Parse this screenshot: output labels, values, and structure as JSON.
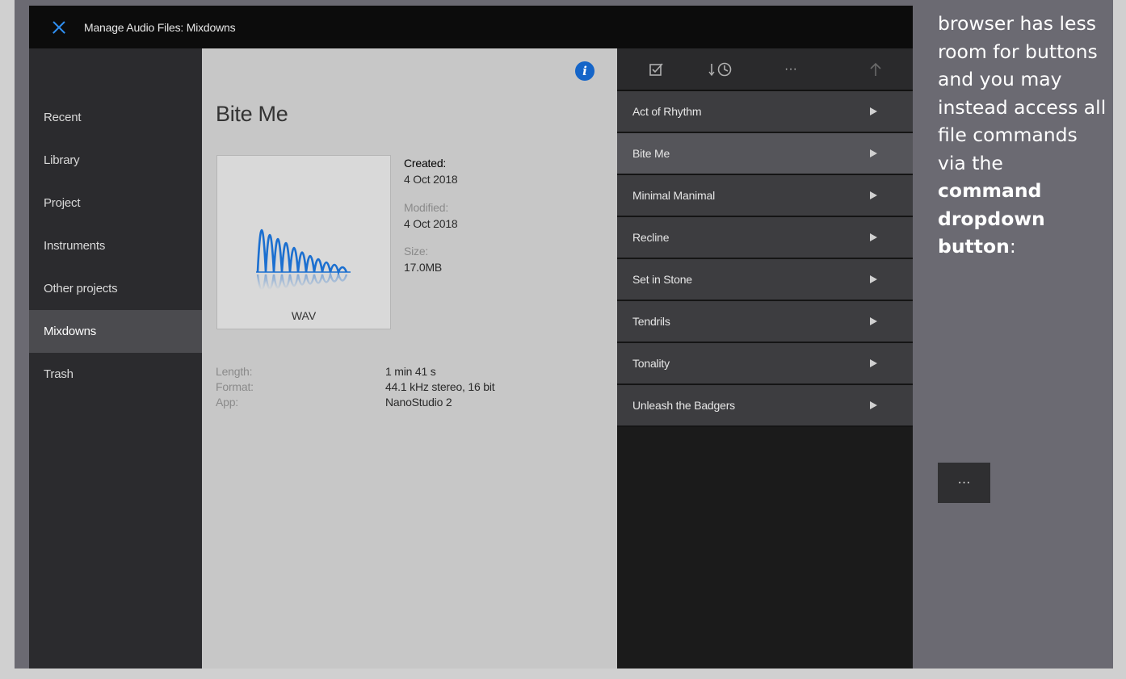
{
  "window": {
    "title": "Manage Audio Files: Mixdowns"
  },
  "sidebar": {
    "items": [
      {
        "label": "Recent"
      },
      {
        "label": "Library"
      },
      {
        "label": "Project"
      },
      {
        "label": "Instruments"
      },
      {
        "label": "Other projects"
      },
      {
        "label": "Mixdowns",
        "active": true
      },
      {
        "label": "Trash"
      }
    ]
  },
  "details": {
    "file_name": "Bite Me",
    "format_badge": "WAV",
    "created_label": "Created:",
    "created_value": "4 Oct 2018",
    "modified_label": "Modified:",
    "modified_value": "4 Oct 2018",
    "size_label": "Size:",
    "size_value": "17.0MB",
    "properties": [
      {
        "key": "Length:",
        "value": "1 min 41 s"
      },
      {
        "key": "Format:",
        "value": "44.1 kHz stereo, 16 bit"
      },
      {
        "key": "App:",
        "value": "NanoStudio 2"
      }
    ],
    "info_icon_glyph": "i"
  },
  "toolbar": {
    "icons": [
      "checklist-icon",
      "sort-by-time-icon",
      "more-options-icon",
      "up-arrow-icon"
    ],
    "more_glyph": "···"
  },
  "files": [
    {
      "name": "Act of Rhythm"
    },
    {
      "name": "Bite Me",
      "selected": true
    },
    {
      "name": "Minimal Manimal"
    },
    {
      "name": "Recline"
    },
    {
      "name": "Set in Stone"
    },
    {
      "name": "Tendrils"
    },
    {
      "name": "Tonality"
    },
    {
      "name": "Unleash the Badgers"
    }
  ],
  "doc": {
    "text_before": "browser has less room for buttons and you may instead access all file commands via the",
    "bold": "command dropdown button",
    "text_after": ":",
    "button_label": "···"
  },
  "colors": {
    "accent": "#2f8ef0",
    "waveform": "#1b6fd0",
    "info": "#1565c8"
  }
}
